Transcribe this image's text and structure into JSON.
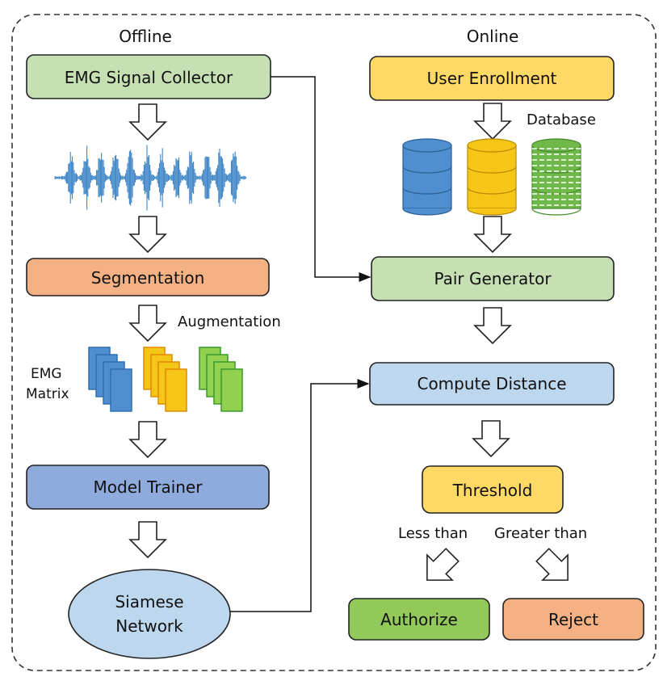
{
  "sections": {
    "offline": "Offline",
    "online": "Online"
  },
  "offline": {
    "collector": "EMG Signal Collector",
    "segmentation": "Segmentation",
    "augmentation": "Augmentation",
    "matrix_label": [
      "EMG",
      "Matrix"
    ],
    "trainer": "Model Trainer",
    "network": [
      "Siamese",
      "Network"
    ]
  },
  "online": {
    "enrollment": "User Enrollment",
    "database": "Database",
    "pair_generator": "Pair Generator",
    "compute_distance": "Compute Distance",
    "threshold": "Threshold",
    "less_than": "Less than",
    "greater_than": "Greater than",
    "authorize": "Authorize",
    "reject": "Reject"
  },
  "colors": {
    "green_box": "#c6e0b4",
    "orange_box": "#f4b183",
    "blue_box": "#8faadc",
    "light_blue": "#bdd7ee",
    "yellow_box": "#ffd966",
    "authorize": "#92c95a",
    "signal": "#3d85c6",
    "db_blue": "#4f8fcf",
    "db_yellow": "#f5c518",
    "db_green": "#70b84a"
  }
}
